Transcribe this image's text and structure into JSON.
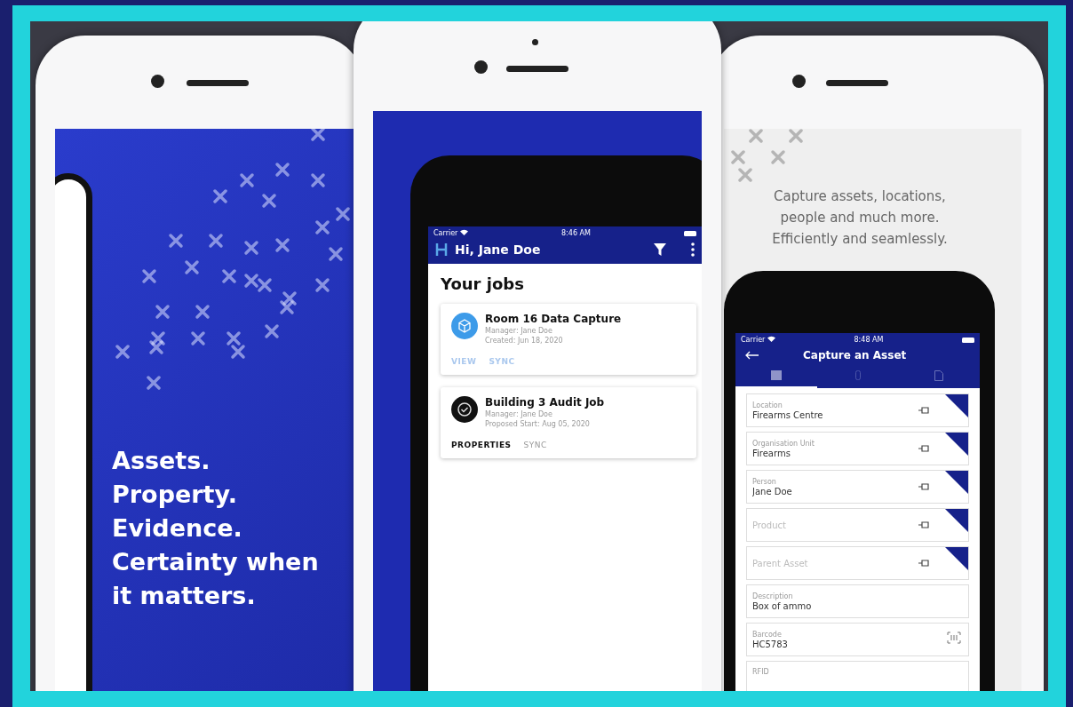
{
  "left_screen": {
    "tagline": [
      "Assets.",
      "Property.",
      "Evidence.",
      "Certainty when",
      "it matters."
    ]
  },
  "center_screen": {
    "status_bar": {
      "carrier": "Carrier",
      "time": "8:46 AM"
    },
    "header": {
      "title": "Hi, Jane Doe"
    },
    "section_title": "Your jobs",
    "jobs": [
      {
        "title": "Room 16 Data Capture",
        "manager": "Manager: Jane Doe",
        "date": "Created: Jun 18, 2020",
        "kind": "cube",
        "color": "#3d9be9",
        "actions": [
          {
            "label": "VIEW",
            "kind": "faded"
          },
          {
            "label": "SYNC",
            "kind": "faded"
          }
        ]
      },
      {
        "title": "Building 3 Audit Job",
        "manager": "Manager: Jane Doe",
        "date": "Proposed Start: Aug 05, 2020",
        "kind": "check",
        "color": "#111111",
        "actions": [
          {
            "label": "PROPERTIES",
            "kind": "strong"
          },
          {
            "label": "SYNC",
            "kind": "muted"
          }
        ]
      }
    ]
  },
  "right_screen": {
    "caption": [
      "Capture assets, locations,",
      "people and much more.",
      "Efficiently and seamlessly."
    ],
    "status_bar": {
      "carrier": "Carrier",
      "time": "8:48 AM"
    },
    "header": {
      "title": "Capture an Asset"
    },
    "tabs": [
      {
        "kind": "list",
        "selected": true
      },
      {
        "kind": "device",
        "selected": false
      },
      {
        "kind": "document",
        "selected": false
      }
    ],
    "fields": [
      {
        "kind": "lookup",
        "label": "Location",
        "value": "Firearms Centre"
      },
      {
        "kind": "lookup",
        "label": "Organisation Unit",
        "value": "Firearms"
      },
      {
        "kind": "lookup",
        "label": "Person",
        "value": "Jane Doe"
      },
      {
        "kind": "lookup",
        "placeholder": "Product"
      },
      {
        "kind": "lookup",
        "placeholder": "Parent Asset"
      },
      {
        "kind": "text",
        "label": "Description",
        "value": "Box of ammo"
      },
      {
        "kind": "barcode",
        "label": "Barcode",
        "value": "HC5783"
      },
      {
        "kind": "text",
        "label": "RFID"
      }
    ]
  }
}
